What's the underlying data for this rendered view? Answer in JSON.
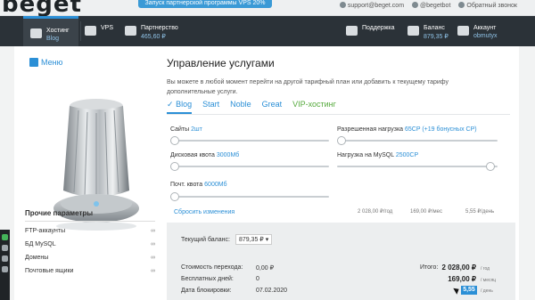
{
  "brand": {
    "logo_text": "beget"
  },
  "promo": "Запуск партнерской программы VPS 20%",
  "contacts": {
    "email": "support@beget.com",
    "twitter": "@begetbot",
    "callback": "Обратный звонок"
  },
  "nav": {
    "hosting": {
      "title": "Хостинг",
      "sub": "Blog"
    },
    "vps": {
      "title": "VPS"
    },
    "partnership": {
      "title": "Партнерство",
      "sub": "465,60 ₽"
    },
    "support": {
      "title": "Поддержка"
    },
    "balance": {
      "title": "Баланс",
      "sub": "879,35 ₽"
    },
    "account": {
      "title": "Аккаунт",
      "sub": "obmutyx"
    }
  },
  "sidebar": {
    "menu_label": "Меню",
    "other_title": "Прочие параметры",
    "items": [
      {
        "label": "FTP-аккаунты",
        "value": "∞"
      },
      {
        "label": "БД MySQL",
        "value": "∞"
      },
      {
        "label": "Домены",
        "value": "∞"
      },
      {
        "label": "Почтовые ящики",
        "value": "∞"
      }
    ]
  },
  "main": {
    "title": "Управление услугами",
    "description": "Вы можете в любой момент перейти на другой тарифный план или добавить к текущему тарифу дополнительные услуги.",
    "tabs": [
      {
        "label": "Blog",
        "check": "✓",
        "active": true
      },
      {
        "label": "Start"
      },
      {
        "label": "Noble"
      },
      {
        "label": "Great"
      },
      {
        "label": "VIP-хостинг"
      }
    ],
    "sliders": [
      {
        "label": "Сайты",
        "value": "2шт",
        "level": 0.02
      },
      {
        "label": "Дисковая квота",
        "value": "3000Мб",
        "level": 0.02
      },
      {
        "label": "Почт. квота",
        "value": "6000Мб",
        "level": 0.02
      },
      {
        "label": "Разрешенная нагрузка",
        "value": "65CP (+19 бонусных CP)",
        "level": 0.02
      },
      {
        "label": "Нагрузка на MySQL",
        "value": "2500CP",
        "level": 0.95
      }
    ],
    "reset_label": "Сбросить изменения",
    "prices": [
      "2 028,00 ₽/год",
      "169,00 ₽/мес",
      "5,55 ₽/день"
    ]
  },
  "billing": {
    "balance_label": "Текущий баланс:",
    "balance_value": "879,35 ₽",
    "transition_cost_label": "Стоимость перехода:",
    "transition_cost_value": "0,00 ₽",
    "free_days_label": "Бесплатных дней:",
    "free_days_value": "0",
    "block_date_label": "Дата блокировки:",
    "block_date_value": "07.02.2020",
    "total_label": "Итого:",
    "total_year": "2 028,00 ₽",
    "unit_year": "/ год",
    "total_month": "169,00 ₽",
    "unit_month": "/ месяц",
    "total_day": "5,55",
    "unit_day": "/ день"
  },
  "colors": {
    "accent": "#2b8fd6",
    "nav_bg": "#2b3238",
    "vip": "#55a93c"
  }
}
